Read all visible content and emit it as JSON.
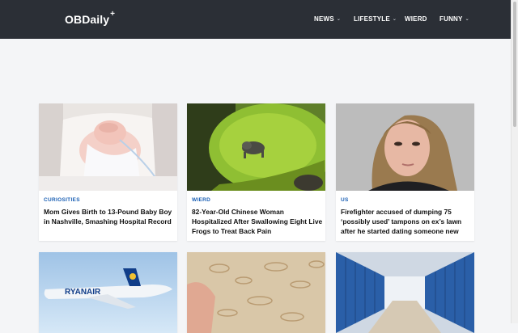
{
  "brand": {
    "name": "OBDaily",
    "mark": "+"
  },
  "nav": [
    {
      "label": "NEWS",
      "dropdown": true
    },
    {
      "label": "LIFESTYLE",
      "dropdown": true
    },
    {
      "label": "WIERD",
      "dropdown": false
    },
    {
      "label": "FUNNY",
      "dropdown": true
    }
  ],
  "articles": [
    {
      "category": "CURIOSITIES",
      "title": "Mom Gives Birth to 13-Pound Baby Boy in Nashville, Smashing Hospital Record"
    },
    {
      "category": "WIERD",
      "title": "82-Year-Old Chinese Woman Hospitalized After Swallowing Eight Live Frogs to Treat Back Pain"
    },
    {
      "category": "US",
      "title": "Firefighter accused of dumping 75 ‘possibly used’ tampons on ex’s lawn after he started dating someone new"
    }
  ],
  "colors": {
    "navbar": "#2b2f36",
    "category": "#1a5fb4",
    "page_bg": "#f4f5f7"
  }
}
